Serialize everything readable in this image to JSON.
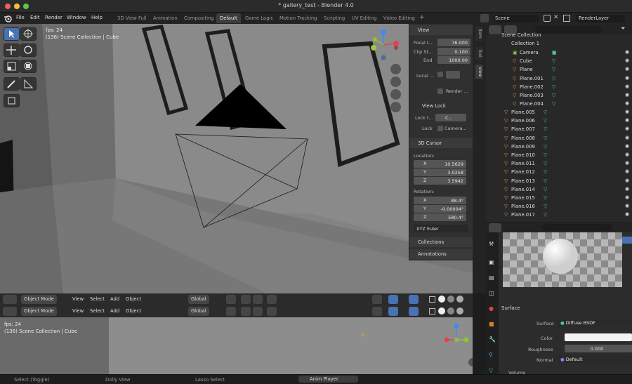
{
  "window": {
    "title": "* gallery_test - Blender 4.0"
  },
  "menus": [
    "File",
    "Edit",
    "Render",
    "Window",
    "Help"
  ],
  "workspaces": {
    "tabs": [
      "3D View Full",
      "Animation",
      "Compositing",
      "Default",
      "Game Logic",
      "Motion Tracking",
      "Scripting",
      "UV Editing",
      "Video Editing"
    ],
    "active": "Default",
    "add": "+"
  },
  "scene": {
    "name": "Scene",
    "render_layer": "RenderLayer"
  },
  "viewport": {
    "fps": "fps: 24",
    "info_frame": "(136) ",
    "info_collection": "Scene Collection",
    "info_sep": " | ",
    "info_object": "Cube"
  },
  "viewport_header": {
    "mode": "Object Mode",
    "menus": [
      "View",
      "Select",
      "Add",
      "Object"
    ],
    "orientation": "Global"
  },
  "bottom_viewport": {
    "fps": "fps: 24",
    "info": "(136) Scene Collection | Cube"
  },
  "npanel": {
    "tabs": [
      "Item",
      "Tool",
      "View"
    ],
    "view": {
      "title": "View",
      "focal_label": "Focal L...",
      "focal": "76.000",
      "clip_label": "Clip St...",
      "clip_start": "0.100",
      "end_label": "End",
      "clip_end": "1000.00",
      "local_label": "Local ...",
      "render_label": "Render ..."
    },
    "viewlock": {
      "title": "View Lock",
      "lock_to_label": "Lock t...",
      "lock_to_value": "C...",
      "lock_label": "Lock",
      "lock_camera": "Camera..."
    },
    "cursor": {
      "title": "3D Cursor",
      "location_label": "Location:",
      "lx": "10.5629",
      "ly": "3.0258",
      "lz": "3.5942",
      "rotation_label": "Rotation:",
      "rx": "88.4°",
      "ry": "-0.00004°",
      "rz": "580.4°",
      "mode": "XYZ Euler",
      "x": "X",
      "y": "Y",
      "z": "Z"
    },
    "collections": "Collections",
    "annotations": "Annotations"
  },
  "outliner": {
    "root": "Scene Collection",
    "collection": "Collection 1",
    "items": [
      "Camera",
      "Cube",
      "Plane",
      "Plane.001",
      "Plane.002",
      "Plane.003",
      "Plane.004"
    ],
    "top_items": [
      "Plane.005",
      "Plane.006",
      "Plane.007",
      "Plane.008",
      "Plane.009",
      "Plane.010",
      "Plane.011",
      "Plane.012",
      "Plane.013",
      "Plane.014",
      "Plane.015",
      "Plane.016",
      "Plane.017"
    ]
  },
  "properties": {
    "surface_title": "Surface",
    "surface_label": "Surface",
    "surface_value": "Diffuse BSDF",
    "color_label": "Color",
    "roughness_label": "Roughness",
    "roughness_value": "0.000",
    "normal_label": "Normal",
    "normal_value": "Default",
    "volume_label": "Volume"
  },
  "statusbar": {
    "select": "Select (Toggle)",
    "dolly": "Dolly View",
    "lasso": "Lasso Select",
    "anim": "Anim Player"
  },
  "colors": {
    "accent": "#4772b3",
    "outliner_object": "#e0944a",
    "mesh_data": "#4fc2a0",
    "gizmo_x": "#e64053",
    "gizmo_y": "#8cc43a",
    "gizmo_z": "#3d8df0"
  }
}
